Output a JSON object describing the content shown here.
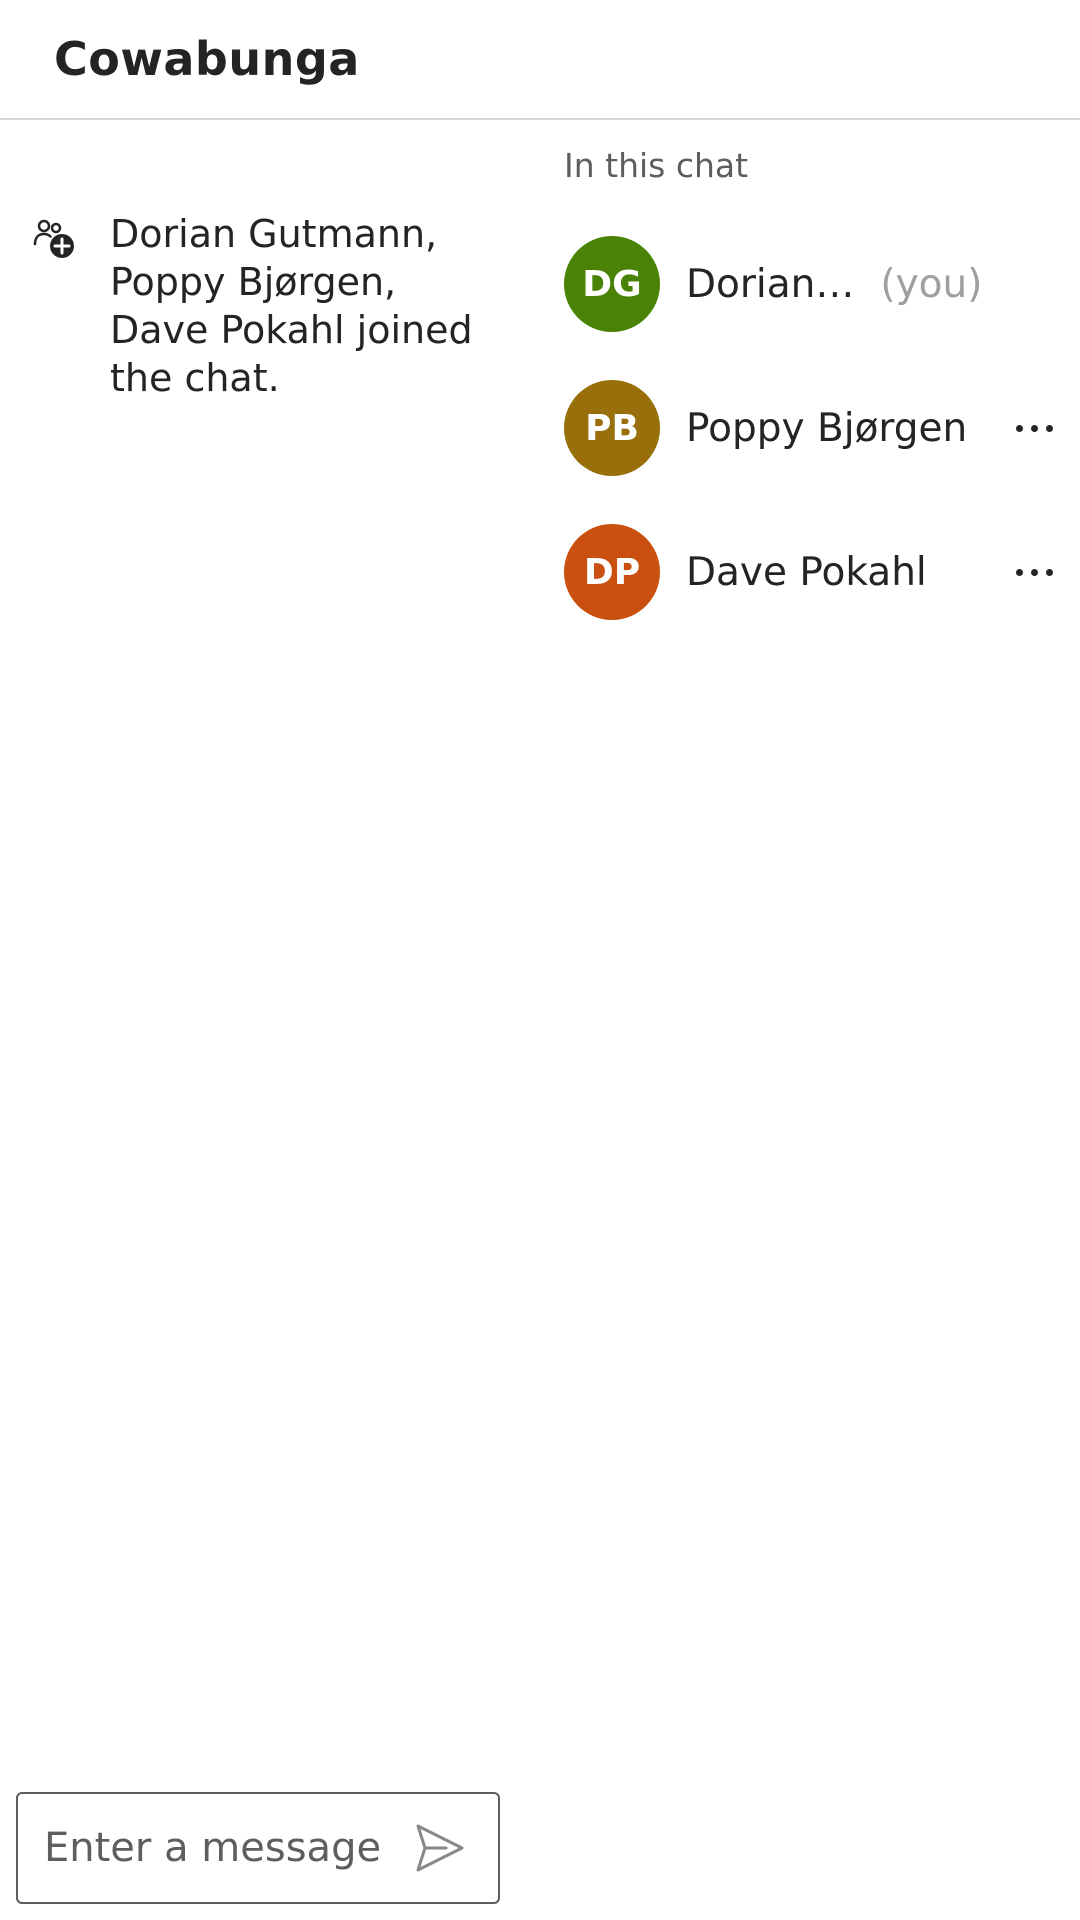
{
  "header": {
    "title": "Cowabunga"
  },
  "chat": {
    "system_message": {
      "icon": "people-add-icon",
      "text": "Dorian Gutmann, Poppy Bjørgen, Dave Pokahl joined the chat."
    }
  },
  "participants": {
    "heading": "In this chat",
    "items": [
      {
        "initials": "DG",
        "name": "Dorian…",
        "you_label": "(you)",
        "color": "#498205",
        "has_more": false
      },
      {
        "initials": "PB",
        "name": "Poppy Bjørgen",
        "you_label": "",
        "color": "#986f0b",
        "has_more": true
      },
      {
        "initials": "DP",
        "name": "Dave Pokahl",
        "you_label": "",
        "color": "#ca5010",
        "has_more": true
      }
    ]
  },
  "composer": {
    "placeholder": "Enter a message",
    "value": "",
    "send_icon": "send-icon"
  },
  "colors": {
    "text": "#252423",
    "muted": "#605e5c",
    "subtle": "#a19f9d",
    "divider": "#d6d6d6"
  }
}
